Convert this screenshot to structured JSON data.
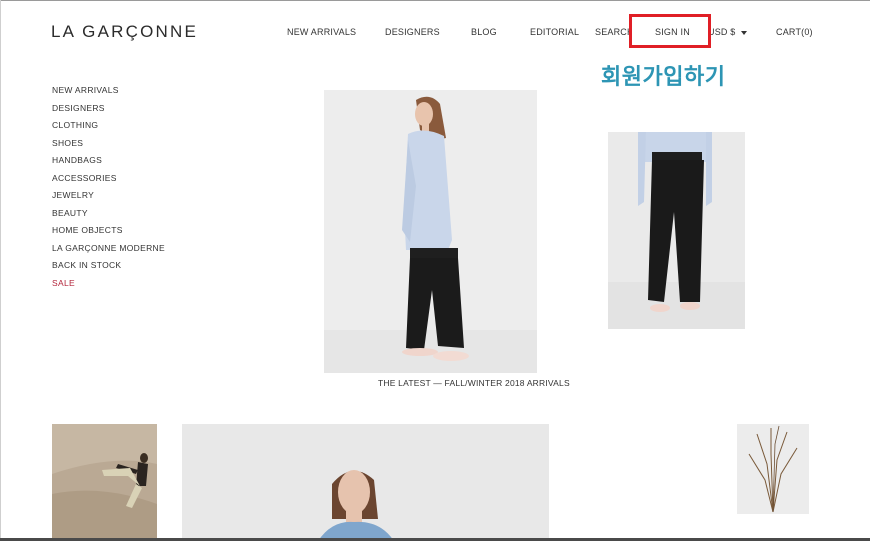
{
  "brand": {
    "logo": "LA GARÇONNE"
  },
  "header": {
    "nav": [
      "NEW ARRIVALS",
      "DESIGNERS",
      "BLOG",
      "EDITORIAL"
    ],
    "search": "SEARCH",
    "sign_in": "SIGN IN",
    "currency": "USD $",
    "cart": "CART(0)"
  },
  "annotation": {
    "text": "회원가입하기",
    "highlight_color": "#e01f26",
    "text_color": "#2d95b4"
  },
  "sidebar": {
    "items": [
      "NEW ARRIVALS",
      "DESIGNERS",
      "CLOTHING",
      "SHOES",
      "HANDBAGS",
      "ACCESSORIES",
      "JEWELRY",
      "BEAUTY",
      "HOME OBJECTS",
      "LA GARÇONNE MODERNE",
      "BACK IN STOCK"
    ],
    "sale": "SALE",
    "sale_color": "#b3263c"
  },
  "main": {
    "caption": "THE LATEST — FALL/WINTER 2018 ARRIVALS"
  }
}
